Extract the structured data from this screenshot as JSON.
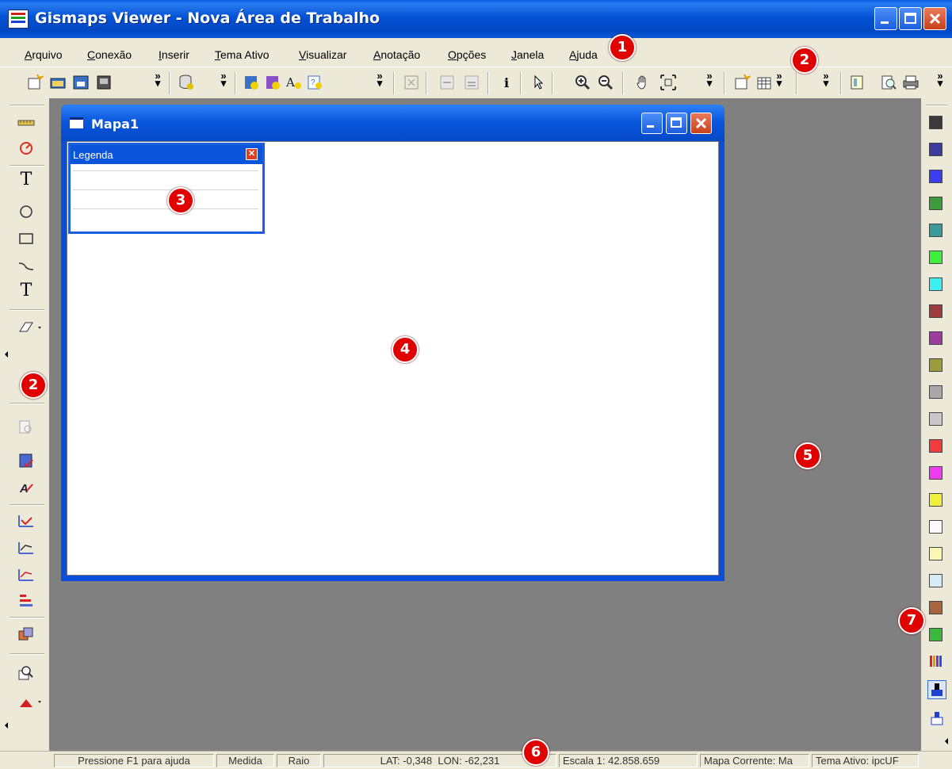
{
  "window": {
    "title": "Gismaps Viewer - Nova Área de Trabalho"
  },
  "menubar": {
    "items": [
      {
        "label": "Arquivo"
      },
      {
        "label": "Conexão"
      },
      {
        "label": "Inserir"
      },
      {
        "label": "Tema Ativo"
      },
      {
        "label": "Visualizar"
      },
      {
        "label": "Anotação"
      },
      {
        "label": "Opções"
      },
      {
        "label": "Janela"
      },
      {
        "label": "Ajuda"
      }
    ]
  },
  "toolbar": {
    "buttons": [
      "new-workspace-icon",
      "open-folder-icon",
      "save-icon",
      "save-as-icon",
      "database-icon",
      "add-layer-icon",
      "add-layer-alt-icon",
      "add-text-layer-icon",
      "add-query-layer-icon",
      "zoom-extent-icon",
      "layer-up-icon",
      "layer-down-icon",
      "info-icon",
      "select-pointer-icon",
      "zoom-in-icon",
      "zoom-out-icon",
      "pan-hand-icon",
      "full-extent-icon",
      "new-map-icon",
      "table-icon",
      "layout-icon",
      "print-preview-icon",
      "print-icon"
    ],
    "overflow_glyph": "»"
  },
  "child_window": {
    "title": "Mapa1"
  },
  "legend": {
    "title": "Legenda",
    "close_glyph": "✕"
  },
  "left_tools": {
    "text_tool_glyph": "T"
  },
  "palette": {
    "colors": [
      "#3a3a3a",
      "#3c3c9c",
      "#3c3cf0",
      "#3c9c3c",
      "#3c9c9c",
      "#3cf03c",
      "#3cf0f0",
      "#9c3c3c",
      "#9c3c9c",
      "#9c9c3c",
      "#a8a8a8",
      "#c8c8c8",
      "#f03c3c",
      "#f03cf0",
      "#f0f03c",
      "#fafafa",
      "#f8f8b0",
      "#d8ecf8",
      "#a8643c",
      "#3cb83c"
    ]
  },
  "callouts": [
    "1",
    "2",
    "3",
    "4",
    "5",
    "2",
    "7",
    "6"
  ],
  "statusbar": {
    "help": "Pressione F1 para ajuda",
    "measure": "Medida",
    "radius": "Raio",
    "coords": "LAT: -0,348  LON: -62,231",
    "scale": "Escala 1: 42.858.659",
    "current_map": "Mapa Corrente: Ma",
    "active_theme": "Tema Ativo: ipcUF"
  }
}
